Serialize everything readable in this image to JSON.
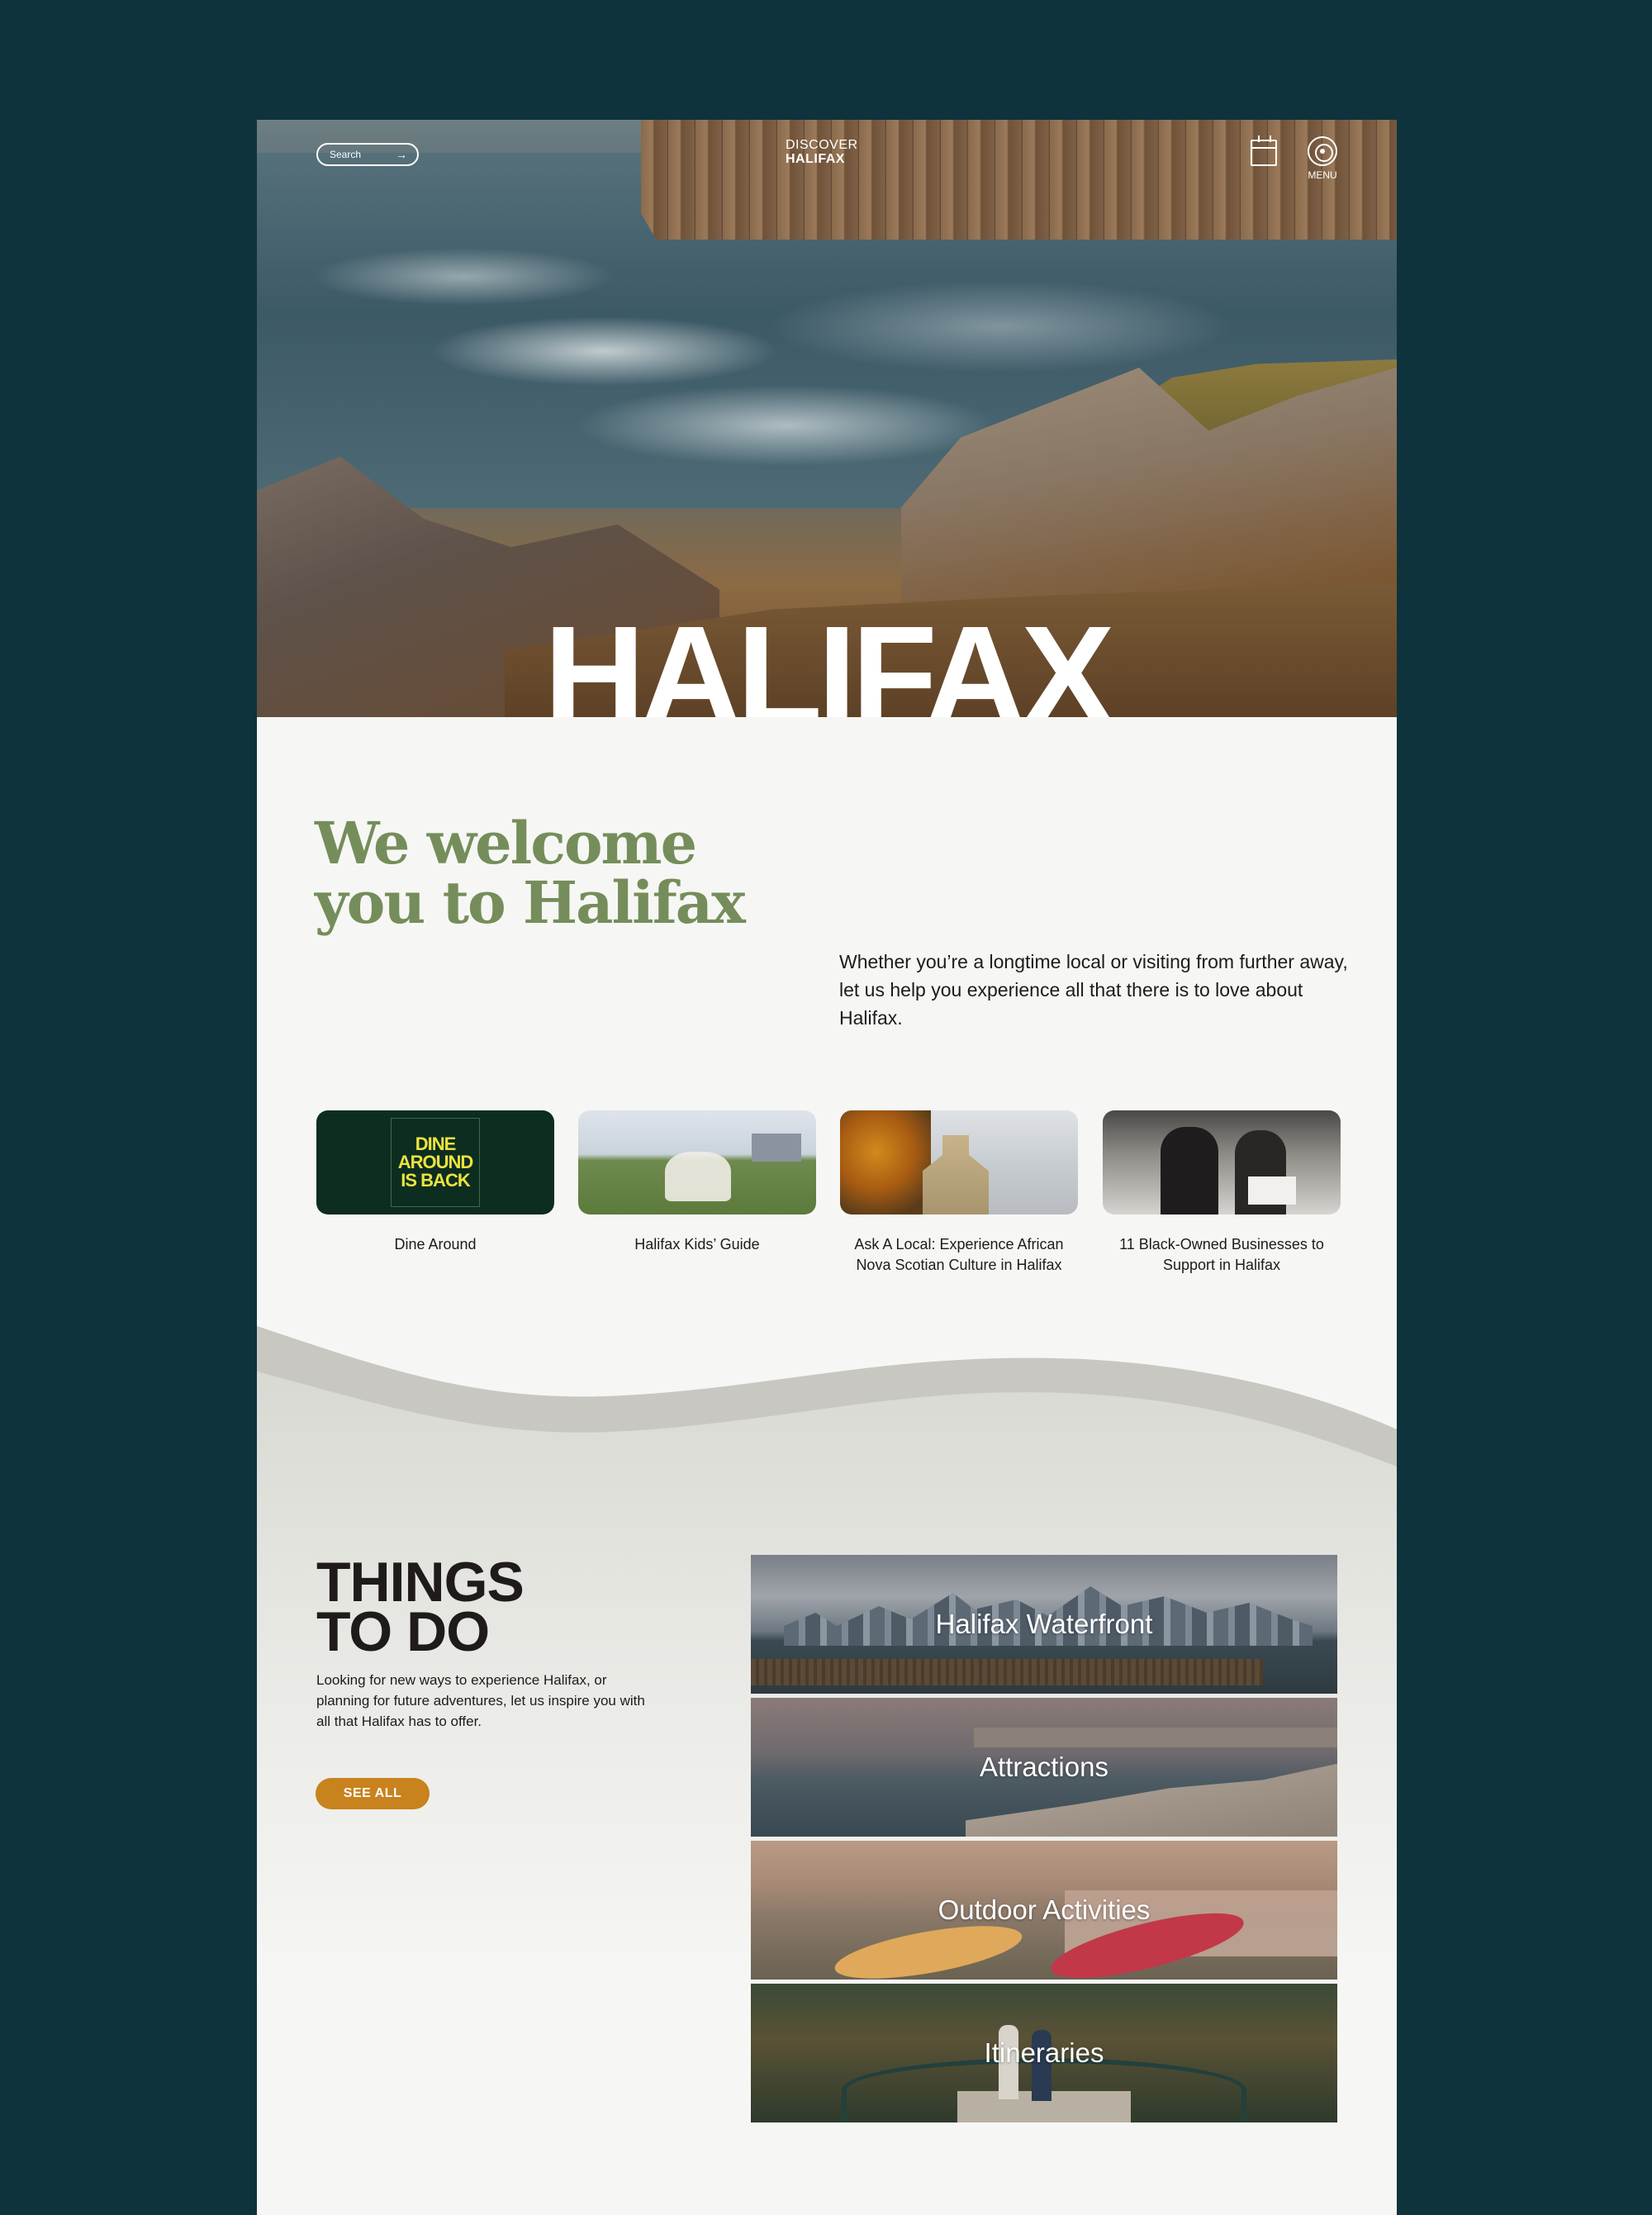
{
  "header": {
    "search_placeholder": "Search",
    "search_arrow": "→",
    "logo_line1": "DISCOVER",
    "logo_line2": "HALIFAX",
    "menu_label": "MENU"
  },
  "hero": {
    "title": "HALIFAX"
  },
  "welcome": {
    "title_line1": "We welcome",
    "title_line2": "you to Halifax",
    "text": "Whether you’re a longtime local or visiting from further away, let us help you experience all that there is to love about Halifax."
  },
  "cards": [
    {
      "caption": "Dine Around",
      "poster_line1": "DINE",
      "poster_line2": "AROUND",
      "poster_line3": "IS BACK"
    },
    {
      "caption": "Halifax Kids’ Guide"
    },
    {
      "caption": "Ask A Local: Experience African Nova Scotian Culture in Halifax"
    },
    {
      "caption": "11 Black-Owned Businesses to Support in Halifax"
    }
  ],
  "things_to_do": {
    "title_line1": "THINGS",
    "title_line2": "TO DO",
    "text": "Looking for new ways to experience Halifax, or planning for future adventures, let us inspire you with all that Halifax has to offer.",
    "button_label": "SEE ALL",
    "tiles": [
      {
        "label": "Halifax Waterfront"
      },
      {
        "label": "Attractions"
      },
      {
        "label": "Outdoor Activities"
      },
      {
        "label": "Itineraries"
      }
    ]
  },
  "colors": {
    "background": "#0e333d",
    "page": "#f6f7f4",
    "welcome_green": "#758d5b",
    "button_orange": "#c8821e"
  },
  "icons": [
    "arrow-right-icon",
    "calendar-icon",
    "menu-target-icon"
  ]
}
